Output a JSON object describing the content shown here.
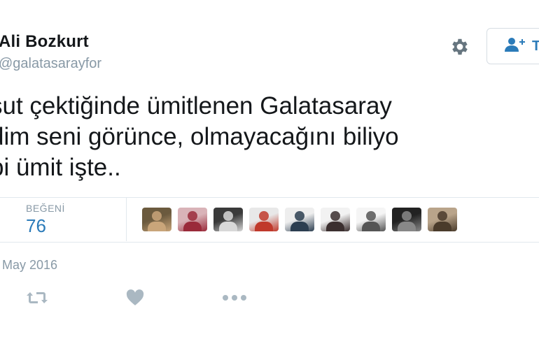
{
  "user": {
    "name": "Ali Bozkurt",
    "handle": "@galatasarayfor"
  },
  "tweet": {
    "lines": [
      "şut çektiğinde ümitlenen Galatasaray",
      "dim seni görünce, olmayacağını biliyo",
      "bi ümit işte.."
    ],
    "date": "May 2016"
  },
  "stats": {
    "likes_label": "BEĞENİ",
    "likes_count": "76"
  },
  "follow_button": {
    "label": "T"
  },
  "icons": {
    "settings": "gear-icon",
    "follow": "add-user-icon",
    "retweet": "retweet-icon",
    "like": "heart-icon",
    "more": "more-dots-icon"
  },
  "colors": {
    "accent": "#2b7bb9",
    "muted": "#8899a6",
    "text": "#14171a",
    "border": "#e1e8ed",
    "action_icon": "#aab8c2"
  },
  "likers": [
    {
      "name": "liker-avatar-1",
      "colors": [
        "#6b5a3e",
        "#c9a57a"
      ]
    },
    {
      "name": "liker-avatar-2",
      "colors": [
        "#d9b3b8",
        "#9a2a3a"
      ]
    },
    {
      "name": "liker-avatar-3",
      "colors": [
        "#3a3a3a",
        "#d8d8d8"
      ]
    },
    {
      "name": "liker-avatar-4",
      "colors": [
        "#e8e8e8",
        "#c0392b"
      ]
    },
    {
      "name": "liker-avatar-5",
      "colors": [
        "#eeeeee",
        "#2c3e50"
      ]
    },
    {
      "name": "liker-avatar-6",
      "colors": [
        "#f2f2f2",
        "#3b2f2f"
      ]
    },
    {
      "name": "liker-avatar-7",
      "colors": [
        "#f5f5f5",
        "#555555"
      ]
    },
    {
      "name": "liker-avatar-8",
      "colors": [
        "#222222",
        "#888888"
      ]
    },
    {
      "name": "liker-avatar-9",
      "colors": [
        "#b9a48a",
        "#4a3b2b"
      ]
    }
  ]
}
